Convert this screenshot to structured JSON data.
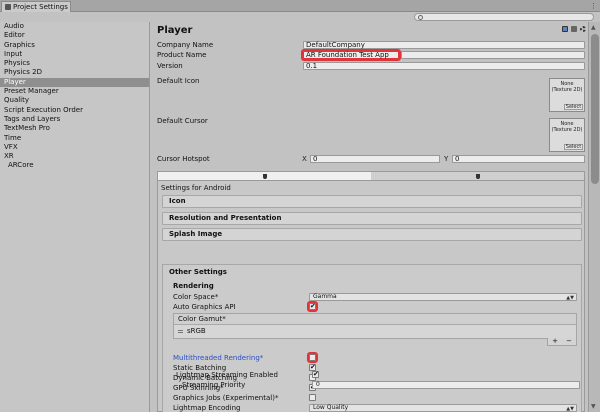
{
  "window": {
    "tab_title": "Project Settings",
    "menu_glyph": "⋮"
  },
  "sidebar": {
    "items": [
      {
        "label": "Audio"
      },
      {
        "label": "Editor"
      },
      {
        "label": "Graphics"
      },
      {
        "label": "Input"
      },
      {
        "label": "Physics"
      },
      {
        "label": "Physics 2D"
      },
      {
        "label": "Player"
      },
      {
        "label": "Preset Manager"
      },
      {
        "label": "Quality"
      },
      {
        "label": "Script Execution Order"
      },
      {
        "label": "Tags and Layers"
      },
      {
        "label": "TextMesh Pro"
      },
      {
        "label": "Time"
      },
      {
        "label": "VFX"
      },
      {
        "label": "XR"
      },
      {
        "label": "ARCore"
      }
    ],
    "selected": "Player"
  },
  "main": {
    "title": "Player",
    "company_name_label": "Company Name",
    "company_name_value": "DefaultCompany",
    "product_name_label": "Product Name",
    "product_name_value": "AR Foundation Test App",
    "version_label": "Version",
    "version_value": "0.1",
    "default_icon_label": "Default Icon",
    "default_cursor_label": "Default Cursor",
    "texture_none": "None",
    "texture_type": "(Texture 2D)",
    "texture_select": "Select",
    "cursor_hotspot_label": "Cursor Hotspot",
    "hotspot_x_label": "X",
    "hotspot_x_value": "0",
    "hotspot_y_label": "Y",
    "hotspot_y_value": "0",
    "settings_for": "Settings for Android",
    "sections": {
      "icon": "Icon",
      "resolution": "Resolution and Presentation",
      "splash": "Splash Image",
      "other": "Other Settings"
    },
    "rendering": {
      "title": "Rendering",
      "color_space_label": "Color Space*",
      "color_space_value": "Gamma",
      "auto_graphics_api_label": "Auto Graphics API",
      "color_gamut_label": "Color Gamut*",
      "color_gamut_item": "sRGB",
      "add_glyph": "+",
      "remove_glyph": "−",
      "multithreaded_label": "Multithreaded Rendering*",
      "static_batching_label": "Static Batching",
      "dynamic_batching_label": "Dynamic Batching",
      "gpu_skinning_label": "GPU Skinning*",
      "graphics_jobs_label": "Graphics Jobs (Experimental)*",
      "lightmap_encoding_label": "Lightmap Encoding",
      "lightmap_encoding_value": "Low Quality",
      "lightmap_streaming_label": "Lightmap Streaming Enabled",
      "streaming_priority_label": "Streaming Priority",
      "streaming_priority_value": "0",
      "check_glyph": "✔"
    },
    "checkbox_states": {
      "auto_graphics_api": true,
      "multithreaded": false,
      "static_batching": true,
      "dynamic_batching": false,
      "gpu_skinning": true,
      "graphics_jobs": false,
      "lightmap_streaming": true
    }
  },
  "colors": {
    "highlight_box": "#e0333a",
    "link_blue": "#2b4fc9",
    "selected_row": "#8f8f8f"
  }
}
